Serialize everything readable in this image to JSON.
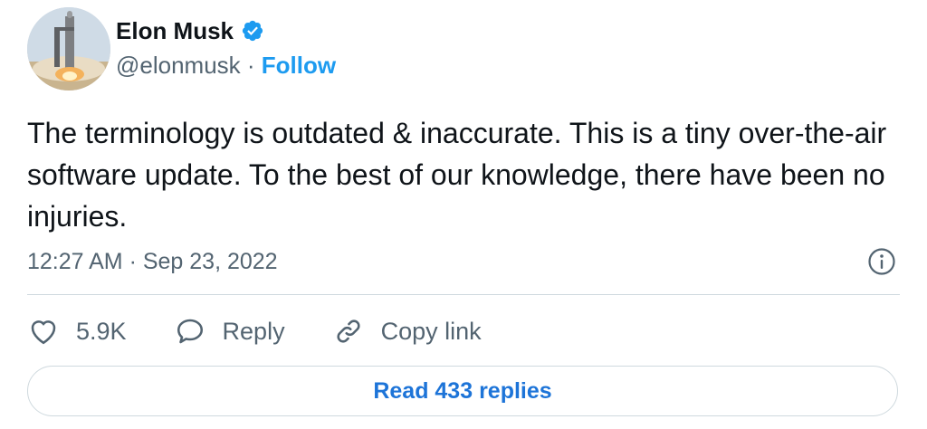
{
  "author": {
    "display_name": "Elon Musk",
    "handle": "@elonmusk",
    "separator": " · ",
    "follow_label": "Follow",
    "avatar_icon": "rocket-launch-avatar",
    "verified_icon": "verified-badge-icon",
    "verified_color": "#1d9bf0"
  },
  "tweet": {
    "text": "The terminology is outdated & inaccurate. This is a tiny over-the-air software update. To the best of our knowledge, there have been no injuries.",
    "timestamp": "12:27 AM · Sep 23, 2022"
  },
  "actions": {
    "like_count": "5.9K",
    "reply_label": "Reply",
    "copy_link_label": "Copy link"
  },
  "footer": {
    "read_replies_label": "Read 433 replies"
  },
  "colors": {
    "accent": "#1d9bf0",
    "secondary_text": "#536471",
    "primary_text": "#0f1419",
    "border": "#cfd9de"
  }
}
